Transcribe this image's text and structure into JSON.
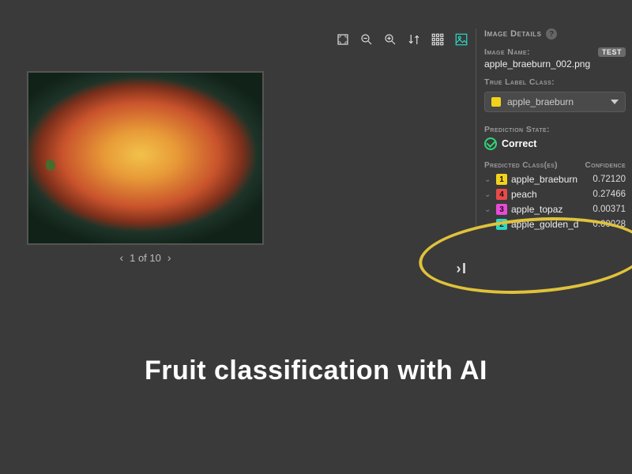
{
  "toolbar": {
    "icons": [
      "fullscreen",
      "zoom-out",
      "zoom-in",
      "sort",
      "grid",
      "image"
    ]
  },
  "viewer": {
    "pager_text": "1 of 10"
  },
  "details": {
    "header": "Image Details",
    "image_name_label": "Image Name:",
    "image_name": "apple_braeburn_002.png",
    "badge": "TEST",
    "true_label_header": "True Label Class:",
    "true_label": {
      "name": "apple_braeburn",
      "color": "#f2d21a"
    },
    "pred_state_label": "Prediction State:",
    "pred_state": "Correct",
    "pred_table": {
      "col1": "Predicted Class(es)",
      "col2": "Confidence",
      "rows": [
        {
          "rank": "1",
          "color": "#f2d21a",
          "name": "apple_braeburn",
          "conf": "0.72120"
        },
        {
          "rank": "4",
          "color": "#e84a4a",
          "name": "peach",
          "conf": "0.27466"
        },
        {
          "rank": "3",
          "color": "#e84ad6",
          "name": "apple_topaz",
          "conf": "0.00371"
        },
        {
          "rank": "2",
          "color": "#2fd6c3",
          "name": "apple_golden_d",
          "conf": "0.00028"
        }
      ]
    }
  },
  "caption": "Fruit classification with AI"
}
